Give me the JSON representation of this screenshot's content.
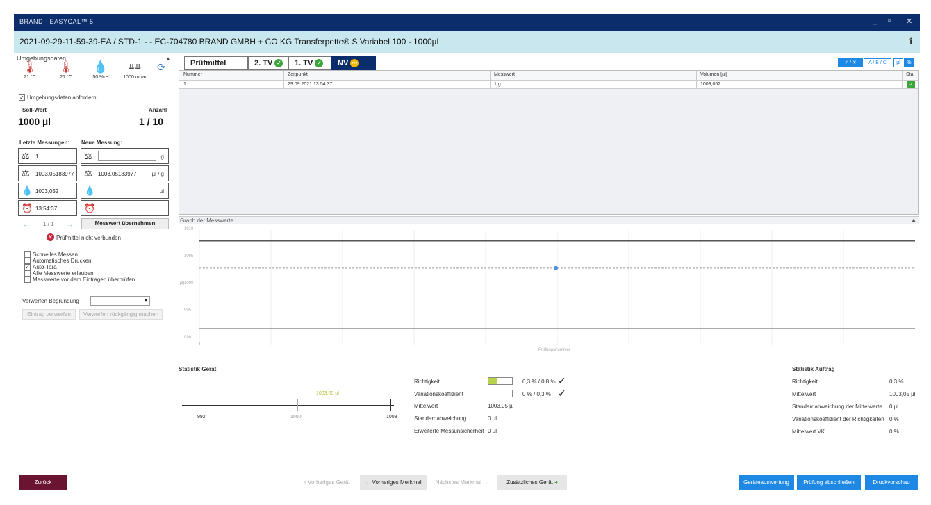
{
  "window": {
    "app_title": "BRAND - EASYCAL™ 5",
    "header_title": "2021-09-29-11-59-39-EA / STD-1 -  - EC-704780 BRAND GMBH + CO KG Transferpette® S Variabel 100 - 1000µl",
    "minimize": "_",
    "maximize": "▫",
    "close": "✕",
    "info": "i"
  },
  "left": {
    "section_title": "Umgebungsdaten",
    "env": [
      {
        "icon": "thermometer-icon",
        "value": "21 °C"
      },
      {
        "icon": "thermometer-icon",
        "value": "21 °C"
      },
      {
        "icon": "humidity-icon",
        "value": "50 %rH"
      },
      {
        "icon": "pressure-icon",
        "value": "1000 mbar"
      }
    ],
    "env_request_label": "Umgebungsdaten anfordern",
    "soll_label": "Soll-Wert",
    "anzahl_label": "Anzahl",
    "soll_value": "1000 µl",
    "anzahl_value": "1 / 10",
    "letzte_label": "Letzte Messungen:",
    "neue_label": "Neue Messung:",
    "last": {
      "weight": "1",
      "factor": "1003,05183977",
      "volume": "1003,052",
      "time": "13:54:37"
    },
    "new": {
      "weight": "",
      "weight_unit": "g",
      "factor": "1003,05183977",
      "factor_unit": "µl / g",
      "volume": "",
      "volume_unit": "µl",
      "time": ""
    },
    "pager": "1 / 1",
    "accept_button": "Messwert übernehmen",
    "device_status": "Prüfmittel nicht verbunden",
    "options": [
      {
        "label": "Schnelles Messen",
        "checked": false
      },
      {
        "label": "Automatisches Drucken",
        "checked": false
      },
      {
        "label": "Auto-Tara",
        "checked": true
      },
      {
        "label": "Alle Messwerte erlauben",
        "checked": false
      },
      {
        "label": "Messwerte vor dem Eintragen überprüfen",
        "checked": false
      }
    ],
    "discard_reason_label": "Verwerfen Begründung",
    "discard_button": "Eintrag verwerfen",
    "undo_discard_button": "Verwerfen rückgängig machen"
  },
  "tabs": [
    {
      "label": "Prüfmittel"
    },
    {
      "label": "2. TV",
      "status": "✓"
    },
    {
      "label": "1. TV",
      "status": "✓"
    },
    {
      "label": "NV",
      "status": "•••"
    }
  ],
  "toolbar_toggles": [
    "✓ / ✕",
    "A / B / C",
    "µl",
    "%"
  ],
  "table": {
    "columns": [
      "Nummer",
      "Zeitpunkt",
      "Messwert",
      "Volumen [µl]",
      "Sta"
    ],
    "rows": [
      {
        "nummer": "1",
        "zeitpunkt": "29.09.2021 13:54:37",
        "messwert": "1 g",
        "volumen": "1003,052",
        "status": "✓"
      }
    ]
  },
  "graph": {
    "title": "Graph der Messwerte",
    "y_labels": [
      "1010",
      "1005",
      "1000",
      "995",
      "990"
    ],
    "y_axis_label": "[µl]",
    "x_tick": "1",
    "x_axis_label": "Prüfungsnummer"
  },
  "chart_data": {
    "type": "scatter",
    "x": [
      1
    ],
    "y": [
      1003.05
    ],
    "ylim": [
      990,
      1010
    ],
    "limit_lines": [
      1008,
      992
    ],
    "mean_line": 1003.05,
    "xlabel": "Prüfungsnummer",
    "ylabel": "[µl]"
  },
  "stats_device": {
    "title": "Statistik Gerät",
    "scale_labels": [
      "992",
      "1000",
      "1008"
    ],
    "marker_label": "1003,05 µl",
    "rows": [
      {
        "label": "Richtigkeit",
        "value": "0,3 % / 0,8 %",
        "check": "✓",
        "fill": 0.375
      },
      {
        "label": "Variationskoeffizient",
        "value": "0 % / 0,3 %",
        "check": "✓",
        "fill": 0.0
      },
      {
        "label": "Mittelwert",
        "value": "1003,05 µl"
      },
      {
        "label": "Standardabweichung",
        "value": "0 µl"
      },
      {
        "label": "Erweiterte Messunsicherheit",
        "value": "0 µl"
      }
    ]
  },
  "stats_order": {
    "title": "Statistik Auftrag",
    "rows": [
      {
        "label": "Richtigkeit",
        "value": "0,3 %"
      },
      {
        "label": "Mittelwert",
        "value": "1003,05 µl"
      },
      {
        "label": "Standardabweichung der Mittelwerte",
        "value": "0 µl"
      },
      {
        "label": "Variationskoeffizient der Richtigkeiten",
        "value": "0 %"
      },
      {
        "label": "Mittelwert VK",
        "value": "0 %"
      }
    ]
  },
  "bottom": {
    "back": "Zurück",
    "prev_device": "Vorheriges Gerät",
    "prev_feature": "Vorheriges Merkmal",
    "next_feature": "Nächstes Merkmal",
    "add_device": "Zusätzliches Gerät",
    "device_eval": "Geräteauswertung",
    "finish": "Prüfung abschließen",
    "print_preview": "Druckvorschau"
  },
  "colors": {
    "titlebar": "#0c2d6b",
    "header": "#c9e7ee",
    "accent": "#1e88e5",
    "back": "#6b1431",
    "ok": "#3aa63a"
  }
}
